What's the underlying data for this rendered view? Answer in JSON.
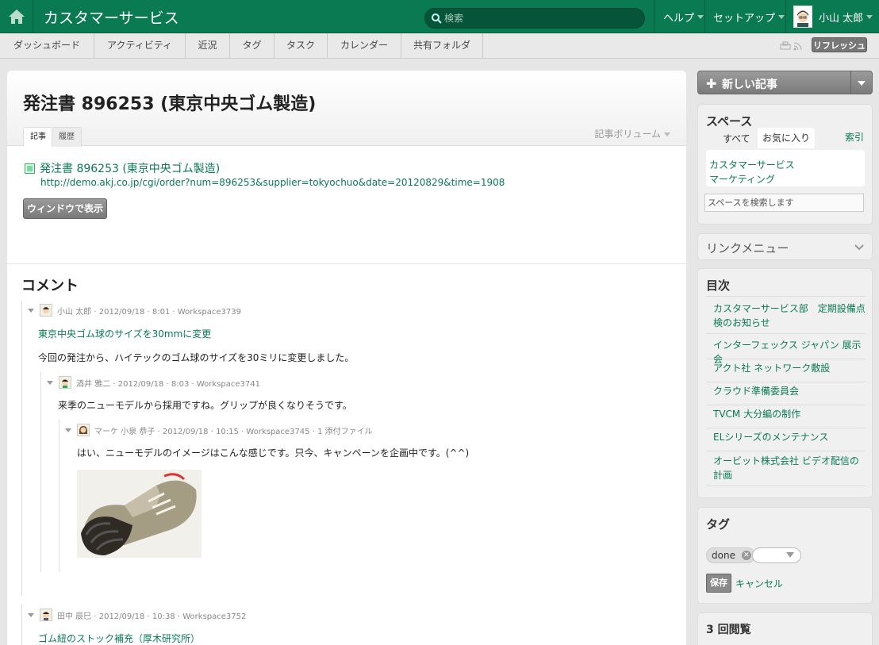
{
  "app": {
    "title": "カスタマーサービス"
  },
  "search": {
    "placeholder": "検索"
  },
  "topmenu": {
    "help": "ヘルプ",
    "setup": "セットアップ",
    "user": "小山 太郎"
  },
  "nav": {
    "items": [
      "ダッシュボード",
      "アクティビティ",
      "近況",
      "タグ",
      "タスク",
      "カレンダー",
      "共有フォルダ"
    ],
    "refresh": "リフレッシュ"
  },
  "page": {
    "title": "発注書 896253 (東京中央ゴム製造)",
    "tabs": [
      "記事",
      "履歴"
    ],
    "volume": "記事ボリューム",
    "link_title": "発注書 896253 (東京中央ゴム製造)",
    "link_url": "http://demo.akj.co.jp/cgi/order?num=896253&supplier=tokyochuo&date=20120829&time=1908",
    "window_button": "ウィンドウで表示"
  },
  "comments": {
    "title": "コメント",
    "items": [
      {
        "meta": "小山 太郎 · 2012/09/18 · 8:01 · Workspace3739",
        "subject": "東京中央ゴム球のサイズを30mmに変更",
        "body": "今回の発注から、ハイテックのゴム球のサイズを30ミリに変更しました。"
      },
      {
        "meta": "酒井 雅二 · 2012/09/18 · 8:03 · Workspace3741",
        "body": "来季のニューモデルから採用ですね。グリップが良くなりそうです。"
      },
      {
        "meta": "マーケ 小泉 恭子 · 2012/09/18 · 10:15 · Workspace3745 · 1 添付ファイル",
        "body": "はい、ニューモデルのイメージはこんな感じです。只今、キャンペーンを企画中です。(^^)"
      },
      {
        "meta": "田中 辰巳 · 2012/09/18 · 10:38 · Workspace3752",
        "subject": "ゴム紐のストック補充（厚木研究所）"
      }
    ]
  },
  "sidebar": {
    "new_article": "新しい記事",
    "spaces": {
      "title": "スペース",
      "tab_all": "すべて",
      "tab_fav": "お気に入り",
      "index": "索引",
      "items": [
        "カスタマーサービス",
        "マーケティング"
      ],
      "search_placeholder": "スペースを検索します"
    },
    "linkmenu": {
      "title": "リンクメニュー"
    },
    "toc": {
      "title": "目次",
      "items": [
        "カスタマーサービス部　定期設備点検のお知らせ",
        "インターフェックス ジャパン 展示会",
        "アクト社 ネットワーク敷設",
        "クラウド準備委員会",
        "TVCM 大分編の制作",
        "ELシリーズのメンテナンス",
        "オービット株式会社 ビデオ配信の計画"
      ]
    },
    "tags": {
      "title": "タグ",
      "tag": "done",
      "save": "保存",
      "cancel": "キャンセル"
    },
    "views": {
      "title": "3 回閲覧"
    }
  }
}
